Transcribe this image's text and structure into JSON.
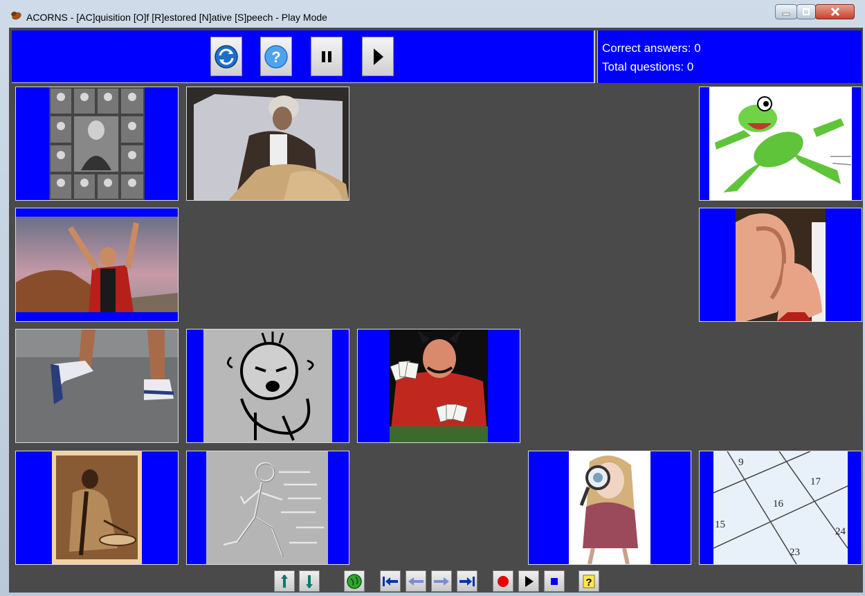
{
  "window": {
    "title": "ACORNS - [AC]quisition [O]f [R]estored [N]ative [S]peech - Play Mode"
  },
  "toolbar": {
    "buttons": [
      {
        "name": "restart-icon",
        "tooltip": ""
      },
      {
        "name": "help-icon",
        "tooltip": ""
      },
      {
        "name": "pause-icon",
        "tooltip": ""
      },
      {
        "name": "play-icon",
        "tooltip": ""
      }
    ]
  },
  "score": {
    "correct": "Correct answers: 0",
    "total": "Total questions: 0"
  },
  "cards": [
    {
      "name": "card-portrait-collage",
      "icon": "portrait-collage-image"
    },
    {
      "name": "card-sick-man",
      "icon": "sick-man-image"
    },
    {
      "name": "card-running-frog",
      "icon": "running-frog-image"
    },
    {
      "name": "card-cheering-man",
      "icon": "cheering-man-image"
    },
    {
      "name": "card-listening-ear",
      "icon": "listening-ear-image"
    },
    {
      "name": "card-running-legs",
      "icon": "running-legs-image"
    },
    {
      "name": "card-crying-cartoon",
      "icon": "crying-cartoon-image"
    },
    {
      "name": "card-card-player",
      "icon": "card-player-image"
    },
    {
      "name": "card-elder-drummer",
      "icon": "elder-drummer-image"
    },
    {
      "name": "card-running-sketch",
      "icon": "running-sketch-image"
    },
    {
      "name": "card-magnifier-girl",
      "icon": "magnifier-girl-image"
    },
    {
      "name": "card-calendar",
      "icon": "calendar-image",
      "dates": [
        "9",
        "17",
        "16",
        "15",
        "24",
        "23"
      ]
    }
  ],
  "colors": {
    "panel_blue": "#0000ff",
    "background": "#4a4a4a"
  }
}
